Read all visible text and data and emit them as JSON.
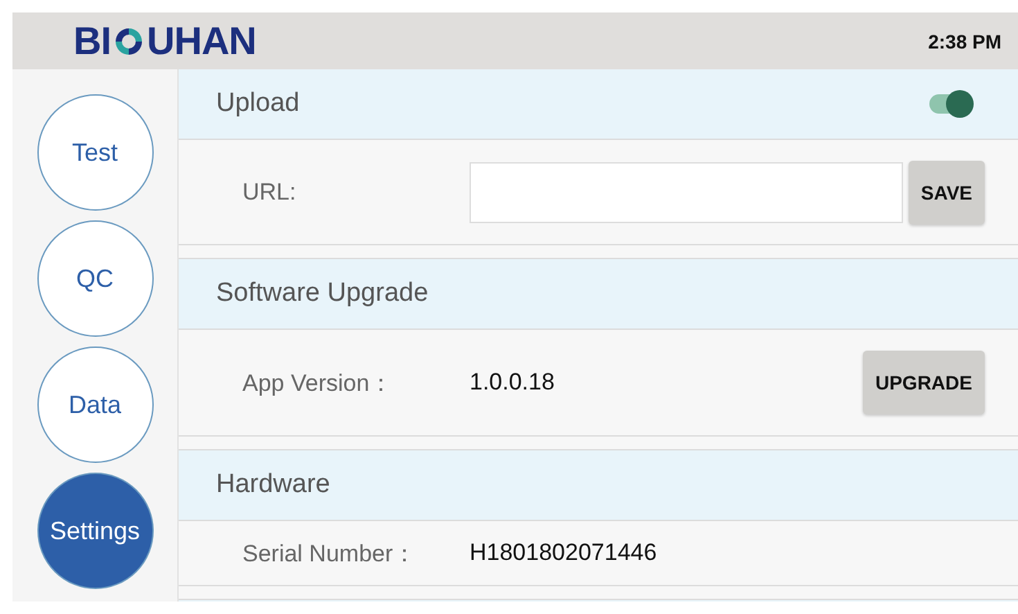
{
  "header": {
    "logo_left": "BI",
    "logo_right": "UHAN",
    "time": "2:38 PM"
  },
  "sidebar": {
    "items": [
      {
        "label": "Test",
        "selected": false
      },
      {
        "label": "QC",
        "selected": false
      },
      {
        "label": "Data",
        "selected": false
      },
      {
        "label": "Settings",
        "selected": true
      }
    ]
  },
  "sections": [
    {
      "title": "Upload",
      "toggle": {
        "on": true
      },
      "rows": [
        {
          "kind": "input",
          "label": "URL:",
          "button": "SAVE"
        }
      ]
    },
    {
      "title": "Software Upgrade",
      "rows": [
        {
          "kind": "value",
          "label": "App Version：",
          "value": "1.0.0.18",
          "button": "UPGRADE"
        }
      ]
    },
    {
      "title": "Hardware",
      "rows": [
        {
          "kind": "value",
          "label": "Serial Number：",
          "value": "H1801802071446"
        }
      ]
    }
  ]
}
